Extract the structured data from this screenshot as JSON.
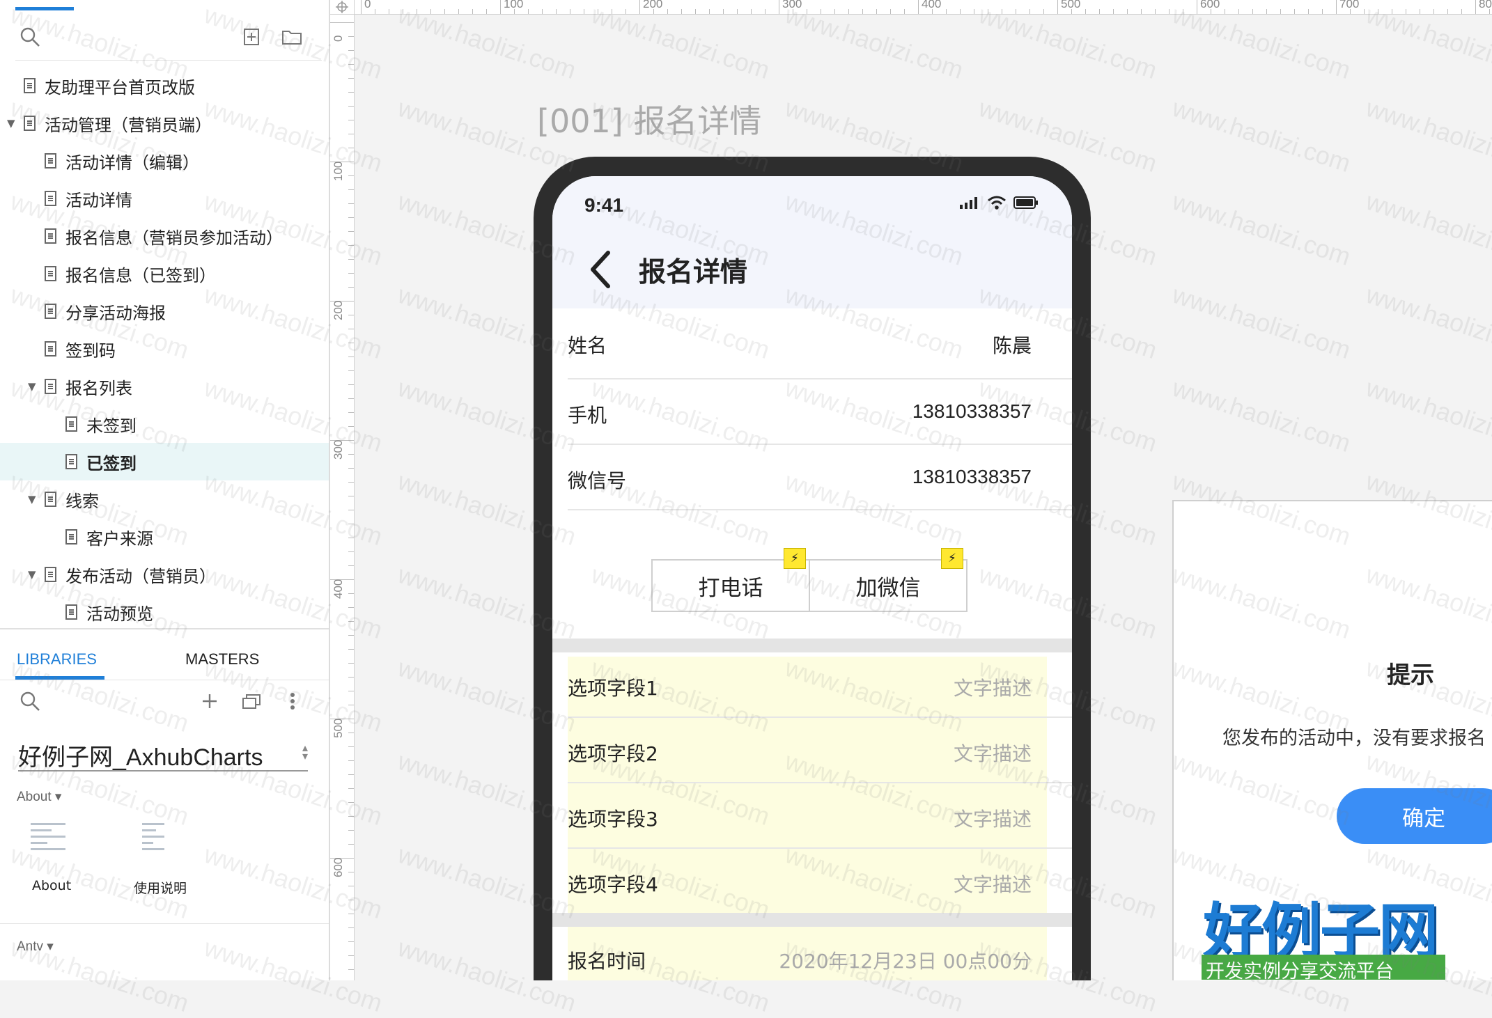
{
  "sitemap": {
    "pages": [
      {
        "label": "友助理平台首页改版",
        "level": 0,
        "expandable": false,
        "selected": false
      },
      {
        "label": "活动管理（营销员端）",
        "level": 0,
        "expandable": true,
        "selected": false
      },
      {
        "label": "活动详情（编辑）",
        "level": 1,
        "expandable": false,
        "selected": false
      },
      {
        "label": "活动详情",
        "level": 1,
        "expandable": false,
        "selected": false
      },
      {
        "label": "报名信息（营销员参加活动）",
        "level": 1,
        "expandable": false,
        "selected": false
      },
      {
        "label": "报名信息（已签到）",
        "level": 1,
        "expandable": false,
        "selected": false
      },
      {
        "label": "分享活动海报",
        "level": 1,
        "expandable": false,
        "selected": false
      },
      {
        "label": "签到码",
        "level": 1,
        "expandable": false,
        "selected": false
      },
      {
        "label": "报名列表",
        "level": 1,
        "expandable": true,
        "selected": false
      },
      {
        "label": "未签到",
        "level": 2,
        "expandable": false,
        "selected": false
      },
      {
        "label": "已签到",
        "level": 2,
        "expandable": false,
        "selected": true
      },
      {
        "label": "线索",
        "level": 1,
        "expandable": true,
        "selected": false
      },
      {
        "label": "客户来源",
        "level": 2,
        "expandable": false,
        "selected": false
      },
      {
        "label": "发布活动（营销员）",
        "level": 1,
        "expandable": true,
        "selected": false
      },
      {
        "label": "活动预览",
        "level": 2,
        "expandable": false,
        "selected": false
      }
    ]
  },
  "libraries": {
    "tab_libraries": "LIBRARIES",
    "tab_masters": "MASTERS",
    "selected_library": "好例子网_AxhubCharts",
    "group_about": "About ▾",
    "group_antv": "Antv ▾",
    "items": [
      {
        "label": "About"
      },
      {
        "label": "使用说明"
      }
    ]
  },
  "ruler": {
    "top_labels": [
      "0",
      "100",
      "200",
      "300",
      "400",
      "500",
      "600",
      "700",
      "80"
    ],
    "left_labels": [
      "0",
      "100",
      "200",
      "300",
      "400",
      "500",
      "600"
    ]
  },
  "canvas": {
    "page_title": "[001] 报名详情"
  },
  "phone": {
    "status_time": "9:41",
    "nav_title": "报名详情",
    "fields": [
      {
        "key": "姓名",
        "value": "陈晨"
      },
      {
        "key": "手机",
        "value": "13810338357"
      },
      {
        "key": "微信号",
        "value": "13810338357"
      }
    ],
    "btn_call": "打电话",
    "btn_wechat": "加微信",
    "options": [
      {
        "key": "选项字段1",
        "value": "文字描述"
      },
      {
        "key": "选项字段2",
        "value": "文字描述"
      },
      {
        "key": "选项字段3",
        "value": "文字描述"
      },
      {
        "key": "选项字段4",
        "value": "文字描述"
      }
    ],
    "time_key": "报名时间",
    "time_value": "2020年12月23日 00点00分"
  },
  "dialog": {
    "title": "提示",
    "message": "您发布的活动中，没有要求报名",
    "confirm": "确定"
  },
  "watermark": {
    "text": "www.haolizi.com",
    "logo_big": "好例子网",
    "logo_small": "开发实例分享交流平台"
  },
  "colors": {
    "accent": "#1f7fd8",
    "selected_row": "#e9f6f7",
    "confirm_button": "#3a8ef6",
    "highlight_area": "#fdfde0"
  }
}
